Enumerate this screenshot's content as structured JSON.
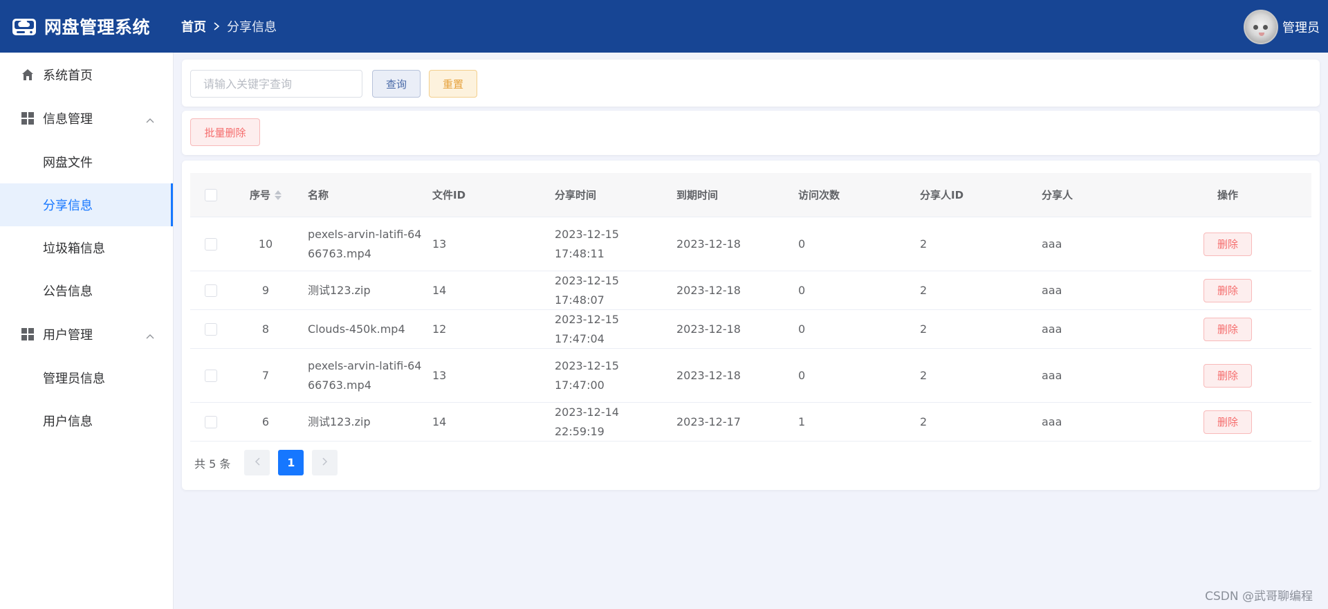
{
  "header": {
    "app_title": "网盘管理系统",
    "breadcrumb_home": "首页",
    "breadcrumb_current": "分享信息",
    "user_name": "管理员"
  },
  "sidebar": {
    "home": "系统首页",
    "group_info": "信息管理",
    "info_items": [
      "网盘文件",
      "分享信息",
      "垃圾箱信息",
      "公告信息"
    ],
    "group_users": "用户管理",
    "user_items": [
      "管理员信息",
      "用户信息"
    ],
    "active_item": "分享信息"
  },
  "search": {
    "placeholder": "请输入关键字查询",
    "query_label": "查询",
    "reset_label": "重置"
  },
  "actions": {
    "batch_delete_label": "批量删除"
  },
  "table": {
    "headers": {
      "index": "序号",
      "name": "名称",
      "file_id": "文件ID",
      "share_time": "分享时间",
      "expire_time": "到期时间",
      "visits": "访问次数",
      "sharer_id": "分享人ID",
      "sharer": "分享人",
      "operation": "操作"
    },
    "delete_label": "删除",
    "rows": [
      {
        "index": "10",
        "name": "pexels-arvin-latifi-6466763.mp4",
        "file_id": "13",
        "share_time": "2023-12-15 17:48:11",
        "expire_time": "2023-12-18",
        "visits": "0",
        "sharer_id": "2",
        "sharer": "aaa"
      },
      {
        "index": "9",
        "name": "测试123.zip",
        "file_id": "14",
        "share_time": "2023-12-15 17:48:07",
        "expire_time": "2023-12-18",
        "visits": "0",
        "sharer_id": "2",
        "sharer": "aaa"
      },
      {
        "index": "8",
        "name": "Clouds-450k.mp4",
        "file_id": "12",
        "share_time": "2023-12-15 17:47:04",
        "expire_time": "2023-12-18",
        "visits": "0",
        "sharer_id": "2",
        "sharer": "aaa"
      },
      {
        "index": "7",
        "name": "pexels-arvin-latifi-6466763.mp4",
        "file_id": "13",
        "share_time": "2023-12-15 17:47:00",
        "expire_time": "2023-12-18",
        "visits": "0",
        "sharer_id": "2",
        "sharer": "aaa"
      },
      {
        "index": "6",
        "name": "测试123.zip",
        "file_id": "14",
        "share_time": "2023-12-14 22:59:19",
        "expire_time": "2023-12-17",
        "visits": "1",
        "sharer_id": "2",
        "sharer": "aaa"
      }
    ]
  },
  "pagination": {
    "total_label": "共 5 条",
    "current_page": "1"
  },
  "watermark": "CSDN @武哥聊编程",
  "colors": {
    "header_bg": "#174594",
    "primary": "#1677ff",
    "danger": "#f56c6c",
    "warning": "#e6a23c",
    "page_bg": "#f1f3fb"
  },
  "icons": {
    "logo": "cloud-drive-icon",
    "home": "home-icon",
    "group": "grid-icon",
    "chevron": "chevron-up-icon",
    "sort": "sort-icon",
    "prev": "chevron-left-icon",
    "next": "chevron-right-icon"
  }
}
